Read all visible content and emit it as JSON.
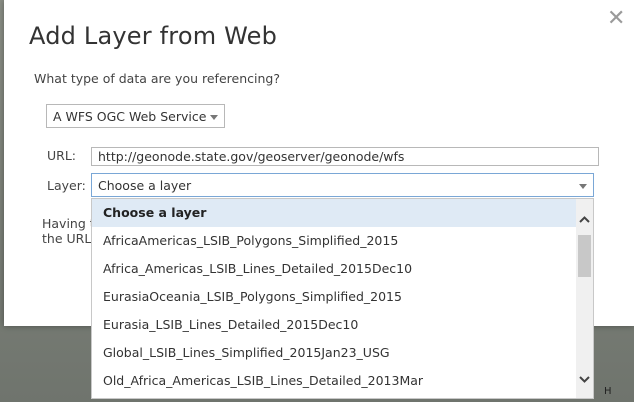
{
  "dialog": {
    "title": "Add Layer from Web",
    "question": "What type of data are you referencing?",
    "type_select": {
      "value": "A WFS OGC Web Service"
    },
    "url": {
      "label": "URL:",
      "value": "http://geonode.state.gov/geoserver/geonode/wfs"
    },
    "layer": {
      "label": "Layer:",
      "value": "Choose a layer"
    },
    "help_line1": "Having t",
    "help_line2": "the URL"
  },
  "dropdown": {
    "options": [
      "Choose a layer",
      "AfricaAmericas_LSIB_Polygons_Simplified_2015",
      "Africa_Americas_LSIB_Lines_Detailed_2015Dec10",
      "EurasiaOceania_LSIB_Polygons_Simplified_2015",
      "Eurasia_LSIB_Lines_Detailed_2015Dec10",
      "Global_LSIB_Lines_Simplified_2015Jan23_USG",
      "Old_Africa_Americas_LSIB_Lines_Detailed_2013Mar"
    ],
    "selected_index": 0
  },
  "map": {
    "label": "H"
  },
  "icons": {
    "close": "close-icon",
    "caret": "chevron-down-icon"
  },
  "colors": {
    "accent_border": "#7aa7d6",
    "selected_bg": "#dfeaf5"
  }
}
